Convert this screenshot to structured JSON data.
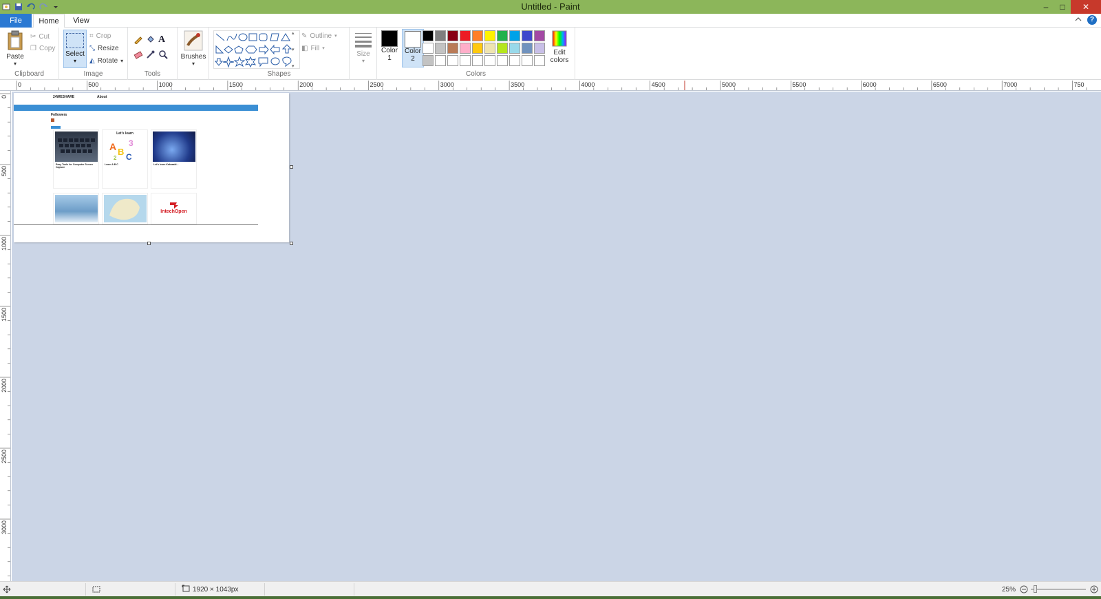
{
  "window": {
    "title": "Untitled - Paint",
    "controls": {
      "minimize": "–",
      "maximize": "□",
      "close": "✕"
    }
  },
  "tabs": {
    "file": "File",
    "home": "Home",
    "view": "View"
  },
  "ribbon": {
    "clipboard": {
      "label": "Clipboard",
      "paste": "Paste",
      "cut": "Cut",
      "copy": "Copy"
    },
    "image": {
      "label": "Image",
      "select": "Select",
      "crop": "Crop",
      "resize": "Resize",
      "rotate": "Rotate"
    },
    "tools": {
      "label": "Tools"
    },
    "brushes": {
      "label": "Brushes"
    },
    "shapes": {
      "label": "Shapes",
      "outline": "Outline",
      "fill": "Fill"
    },
    "size": {
      "label": "Size"
    },
    "colors": {
      "label": "Colors",
      "color1": "Color\n1",
      "color1_a": "Color",
      "color1_b": "1",
      "color2_a": "Color",
      "color2_b": "2",
      "edit_a": "Edit",
      "edit_b": "colors",
      "color1_value": "#000000",
      "color2_value": "#ffffff",
      "palette": [
        "#000000",
        "#7f7f7f",
        "#880015",
        "#ed1c24",
        "#ff7f27",
        "#fff200",
        "#22b14c",
        "#00a2e8",
        "#3f48cc",
        "#a349a4",
        "#ffffff",
        "#c3c3c3",
        "#b97a57",
        "#ffaec9",
        "#ffc90e",
        "#efe4b0",
        "#b5e61d",
        "#99d9ea",
        "#7092be",
        "#c8bfe7",
        "#c3c3c3",
        "#ffffff",
        "#ffffff",
        "#ffffff",
        "#ffffff",
        "#ffffff",
        "#ffffff",
        "#ffffff",
        "#ffffff",
        "#ffffff"
      ]
    }
  },
  "ruler": {
    "h_labels": [
      "0",
      "500",
      "1000",
      "1500",
      "2000",
      "2500",
      "3000",
      "3500",
      "4000",
      "4500",
      "5000",
      "5500",
      "6000",
      "6500",
      "7000",
      "750"
    ],
    "v_labels": [
      "0",
      "500",
      "1000",
      "1500",
      "2000",
      "2500",
      "3000"
    ]
  },
  "canvas_content": {
    "brand": "24WESHARE",
    "about": "About",
    "followers": "Followers",
    "card_titles": [
      "Easy Tools for Computer Screen Capture",
      "Learn A B C",
      "Let's learn Kakaaaki...",
      "",
      "",
      "IntechOpen"
    ],
    "lets_learn": "Let's learn",
    "intech": "IntechOpen"
  },
  "status": {
    "dimensions": "1920 × 1043px",
    "zoom": "25%"
  }
}
